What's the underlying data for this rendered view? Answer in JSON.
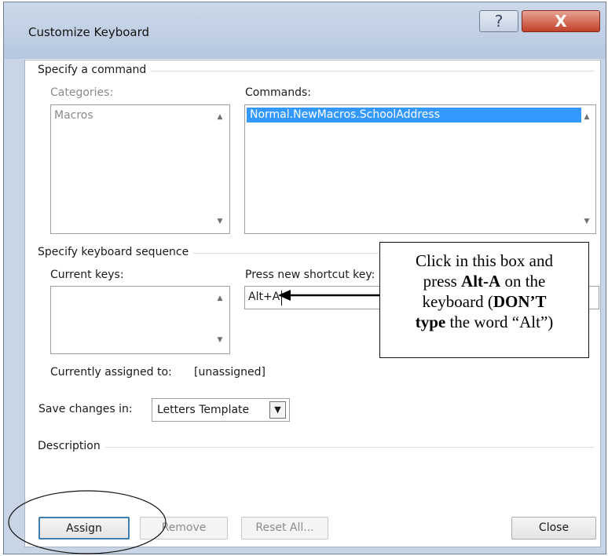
{
  "window": {
    "title": "Customize Keyboard",
    "help_glyph": "?",
    "close_glyph": "X"
  },
  "specify_command": {
    "group_label": "Specify a command",
    "categories_label": "Categories:",
    "categories_items": [
      "Macros"
    ],
    "commands_label": "Commands:",
    "commands_items": [
      "Normal.NewMacros.SchoolAddress"
    ]
  },
  "keyboard_sequence": {
    "group_label": "Specify keyboard sequence",
    "current_keys_label": "Current keys:",
    "new_shortcut_label": "Press new shortcut key:",
    "new_shortcut_value": "Alt+A",
    "currently_assigned_label": "Currently assigned to:",
    "currently_assigned_value": "[unassigned]"
  },
  "save_changes": {
    "label": "Save changes in:",
    "value": "Letters Template"
  },
  "description": {
    "group_label": "Description"
  },
  "buttons": {
    "assign": "Assign",
    "remove": "Remove",
    "reset_all": "Reset All...",
    "close": "Close"
  },
  "callout": {
    "line1": "Click in this box and",
    "line2_pre": "press ",
    "line2_bold": "Alt-A",
    "line2_post": " on the",
    "line3_pre": "keyboard (",
    "line3_bold": "DON’T",
    "line4_bold": "type",
    "line4_post": " the word “Alt”)"
  },
  "colors": {
    "selection": "#3399ff",
    "title_gradient_top": "#cdd9ea",
    "close_button": "#c2402a"
  }
}
